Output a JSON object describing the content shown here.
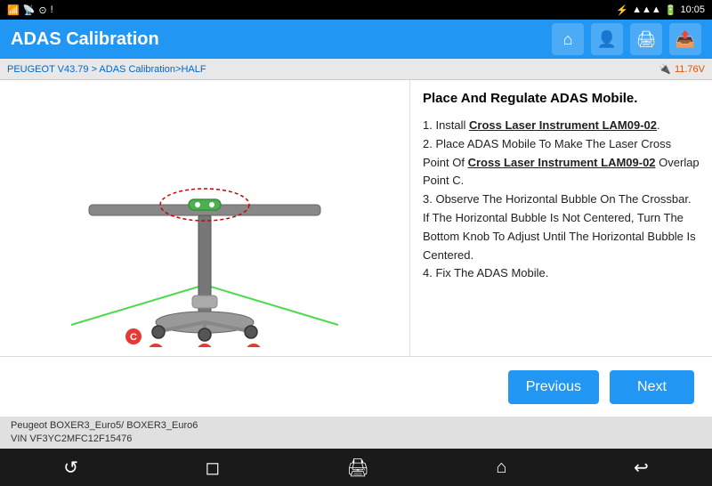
{
  "statusBar": {
    "leftIcons": "📶",
    "time": "10:05",
    "rightIcons": "🔋"
  },
  "header": {
    "title": "ADAS Calibration",
    "icons": {
      "home": "⌂",
      "user": "👤",
      "print": "🖨",
      "export": "📤"
    }
  },
  "breadcrumb": {
    "text": "PEUGEOT V43.79 > ADAS Calibration>HALF",
    "battery": "11.76V"
  },
  "instructions": {
    "title": "Place And Regulate ADAS Mobile.",
    "steps": [
      {
        "num": "1",
        "text": "Install ",
        "link": "Cross Laser Instrument LAM09-02",
        "rest": "."
      },
      {
        "num": "2",
        "text": "Place ADAS Mobile To Make The Laser Cross Point Of ",
        "link": "Cross Laser Instrument LAM09-02",
        "rest": " Overlap Point C."
      },
      {
        "num": "3",
        "text": "Observe The Horizontal Bubble On The Crossbar. If The Horizontal Bubble Is Not Centered, Turn The Bottom Knob To Adjust Until The Horizontal Bubble Is Centered."
      },
      {
        "num": "4",
        "text": "Fix The ADAS Mobile."
      }
    ]
  },
  "buttons": {
    "previous": "Previous",
    "next": "Next"
  },
  "infoBar": {
    "line1": "Peugeot BOXER3_Euro5/ BOXER3_Euro6",
    "line2": "VIN VF3YC2MFC12F15476"
  }
}
